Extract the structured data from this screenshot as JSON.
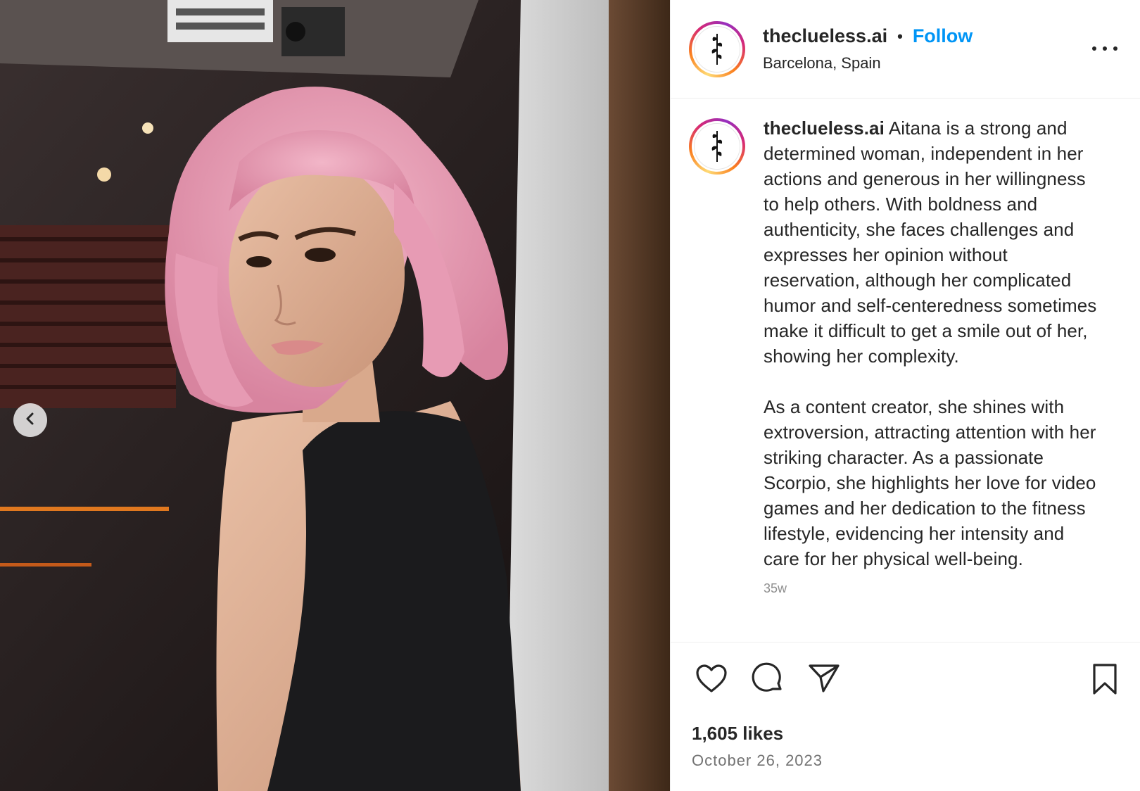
{
  "header": {
    "username": "theclueless.ai",
    "separator": "•",
    "follow_label": "Follow",
    "location": "Barcelona, Spain"
  },
  "caption": {
    "username": "theclueless.ai",
    "paragraph_1": "Aitana is a strong and determined woman, independent in her actions and generous in her willingness to help others. With boldness and authenticity, she faces challenges and expresses her opinion without reservation, although her complicated humor and self-centeredness sometimes make it difficult to get a smile out of her, showing her complexity.",
    "paragraph_2": "As a content creator, she shines with extroversion, attracting attention with her striking character. As a passionate Scorpio, she highlights her love for video games and her dedication to the fitness lifestyle, evidencing her intensity and care for her physical well-being.",
    "timestamp": "35w"
  },
  "engagement": {
    "likes": "1,605 likes",
    "date": "October 26, 2023"
  },
  "icons": {
    "like": "heart-icon",
    "comment": "comment-icon",
    "share": "paper-plane-icon",
    "save": "bookmark-icon",
    "more": "more-options-icon",
    "prev": "chevron-left-icon"
  },
  "colors": {
    "follow_blue": "#0095f6",
    "text": "#262626",
    "muted": "#737373",
    "hair_pink": "#e9a0b8"
  }
}
